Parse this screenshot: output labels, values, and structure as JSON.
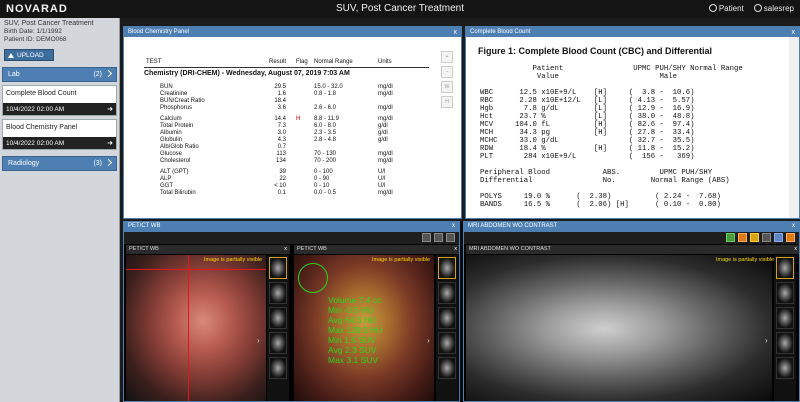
{
  "app": {
    "logo": "NOVARAD",
    "title": "SUV, Post Cancer Treatment",
    "patient_menu": "Patient",
    "user_menu": "salesrep"
  },
  "sidebar": {
    "patient_name": "SUV, Post Cancer Treatment",
    "birth_date": "Birth Date: 1/1/1992",
    "patient_id": "Patient ID: DEMO068",
    "upload_label": "UPLOAD",
    "lab": {
      "label": "Lab",
      "count": "(2)"
    },
    "docs": [
      {
        "title": "Complete Blood Count",
        "date": "10/4/2022 02:00 AM"
      },
      {
        "title": "Blood Chemistry Panel",
        "date": "10/4/2022 02:00 AM"
      }
    ],
    "radiology": {
      "label": "Radiology",
      "count": "(3)"
    }
  },
  "blood_chem": {
    "panel_title": "Blood Chemistry Panel",
    "close": "x",
    "headers": {
      "test": "TEST",
      "result": "Result",
      "flag": "Flag",
      "range": "Normal Range",
      "units": "Units"
    },
    "section": "Chemistry (DRI-CHEM) - Wednesday, August 07, 2019 7:03 AM",
    "groups": [
      [
        {
          "test": "BUN",
          "result": "29.5",
          "flag": "",
          "range": "15.0 - 32.0",
          "units": "mg/dl"
        },
        {
          "test": "Creatinine",
          "result": "1.6",
          "flag": "",
          "range": "0.8 - 1.8",
          "units": "mg/dl"
        },
        {
          "test": "BUN/Creat Ratio",
          "result": "18.4",
          "flag": "",
          "range": "",
          "units": ""
        },
        {
          "test": "Phosphorus",
          "result": "3.6",
          "flag": "",
          "range": "2.6 - 6.0",
          "units": "mg/dl"
        }
      ],
      [
        {
          "test": "Calcium",
          "result": "14.4",
          "flag": "H",
          "range": "8.8 - 11.9",
          "units": "mg/dl"
        },
        {
          "test": "Total Protein",
          "result": "7.3",
          "flag": "",
          "range": "6.0 - 8.0",
          "units": "g/dl"
        },
        {
          "test": "Albumin",
          "result": "3.0",
          "flag": "",
          "range": "2.3 - 3.5",
          "units": "g/dl"
        },
        {
          "test": "Globulin",
          "result": "4.3",
          "flag": "",
          "range": "2.8 - 4.8",
          "units": "g/dl"
        },
        {
          "test": "Alb/Glob Ratio",
          "result": "0.7",
          "flag": "",
          "range": "",
          "units": ""
        },
        {
          "test": "Glucose",
          "result": "113",
          "flag": "",
          "range": "70 - 130",
          "units": "mg/dl"
        },
        {
          "test": "Cholesterol",
          "result": "134",
          "flag": "",
          "range": "70 - 200",
          "units": "mg/dl"
        }
      ],
      [
        {
          "test": "ALT (GPT)",
          "result": "39",
          "flag": "",
          "range": "0 - 100",
          "units": "U/l"
        },
        {
          "test": "ALP",
          "result": "22",
          "flag": "",
          "range": "0 - 90",
          "units": "U/l"
        },
        {
          "test": "GGT",
          "result": "< 10",
          "flag": "",
          "range": "0 - 10",
          "units": "U/l"
        },
        {
          "test": "Total Bilirubin",
          "result": "0.1",
          "flag": "",
          "range": "0.0 - 0.5",
          "units": "mg/dl"
        }
      ]
    ]
  },
  "cbc": {
    "panel_title": "Complete Blood Count",
    "close": "x",
    "figure_title": "Figure 1: Complete Blood Count (CBC) and Differential",
    "lines": [
      "            Patient                UPMC PUH/SHY Normal Range",
      "             Value                       Male",
      "",
      "WBC      12.5 x10E+9/L    [H]     (  3.8 -  10.6)",
      "RBC      2.28 x10E+12/L   [L]     ( 4.13 -  5.57)",
      "Hgb       7.8 g/dL        [L]     ( 12.9 -  16.9)",
      "Hct      23.7 %           [L]     ( 38.0 -  48.8)",
      "MCV     104.0 fL          [H]     ( 82.6 -  97.4)",
      "MCH      34.3 pg          [H]     ( 27.8 -  33.4)",
      "MCHC     33.0 g/dL                ( 32.7 -  35.5)",
      "RDW      18.4 %           [H]     ( 11.8 -  15.2)",
      "PLT       284 x10E+9/L            (  156 -   369)",
      "",
      "Peripheral Blood            ABS.         UPMC PUH/SHY",
      "Differential                No.        Normal Range (ABS)",
      "",
      "POLYS     19.0 %      (  2.38)          ( 2.24 -  7.68)",
      "BANDS     16.5 %      (  2.06) [H]      ( 0.10 -  0.80)"
    ]
  },
  "viewer": {
    "petct": {
      "panel_title": "PET/CT WB",
      "close": "x",
      "sub_left": "PET/CT WB",
      "sub_right": "PET/CT WB",
      "partial_msg": "Image is partially visible",
      "stats": [
        "Volume 7.4 cc",
        "Min -0.5 HU",
        "Avg 64.3 HU",
        "Max 129.5 HU",
        "Min 1.5 SUV",
        "Avg 2.3 SUV",
        "Max 3.1 SUV"
      ]
    },
    "mri": {
      "panel_title": "MRI ABDOMEN WO CONTRAST",
      "close": "x",
      "sub_title": "MRI ABDOMEN WO CONTRAST",
      "partial_msg": "Image is partially visible"
    }
  },
  "colors": {
    "accent": "#4d7fb3",
    "flag_high": "#cc0000",
    "roi": "#29d61e",
    "warning": "#ffd800"
  }
}
